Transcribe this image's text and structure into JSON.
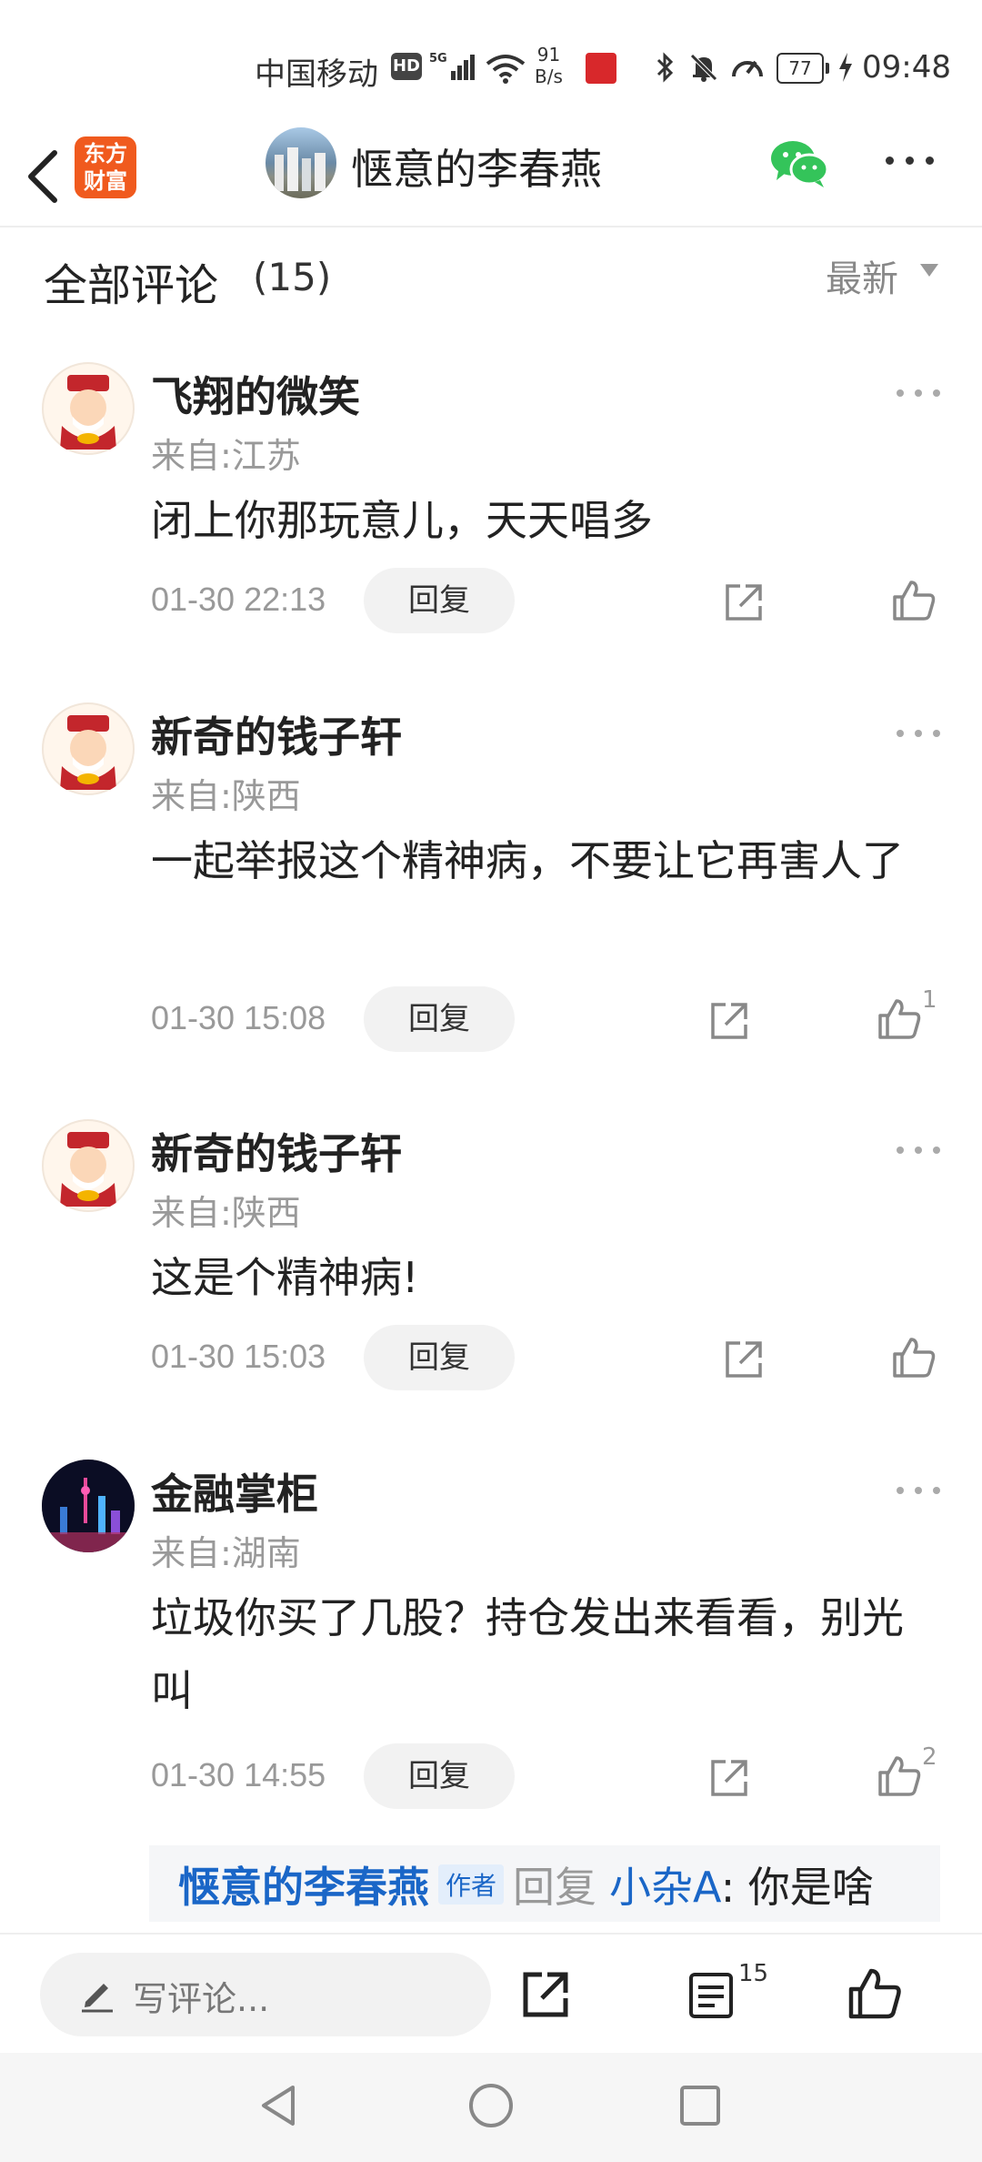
{
  "status_bar": {
    "carrier": "中国移动",
    "hd": "HD",
    "net_gen": "5G",
    "rate_value": "91",
    "rate_unit": "B/s",
    "battery": "77",
    "time": "09:48"
  },
  "header": {
    "logo_line1": "东方",
    "logo_line2": "财富",
    "title": "惬意的李春燕"
  },
  "comments_section": {
    "title": "全部评论",
    "count": "(15)",
    "sort_label": "最新"
  },
  "comments": [
    {
      "name": "飞翔的微笑",
      "location": "来自:江苏",
      "text": "闭上你那玩意儿，天天唱多",
      "time": "01-30 22:13",
      "reply_label": "回复",
      "likes": ""
    },
    {
      "name": "新奇的钱子轩",
      "location": "来自:陕西",
      "text": "一起举报这个精神病，不要让它再害人了",
      "time": "01-30 15:08",
      "reply_label": "回复",
      "likes": "1"
    },
    {
      "name": "新奇的钱子轩",
      "location": "来自:陕西",
      "text": "这是个精神病!",
      "time": "01-30 15:03",
      "reply_label": "回复",
      "likes": ""
    },
    {
      "name": "金融掌柜",
      "location": "来自:湖南",
      "text": "垃圾你买了几股？持仓发出来看看，别光叫",
      "time": "01-30 14:55",
      "reply_label": "回复",
      "likes": "2"
    }
  ],
  "quoted_reply": {
    "author": "惬意的李春燕",
    "author_tag": "作者",
    "action": "回复",
    "target": "小杂A",
    "text": ": 你是啥"
  },
  "bottom_bar": {
    "input_placeholder": "写评论...",
    "comment_count": "15"
  }
}
